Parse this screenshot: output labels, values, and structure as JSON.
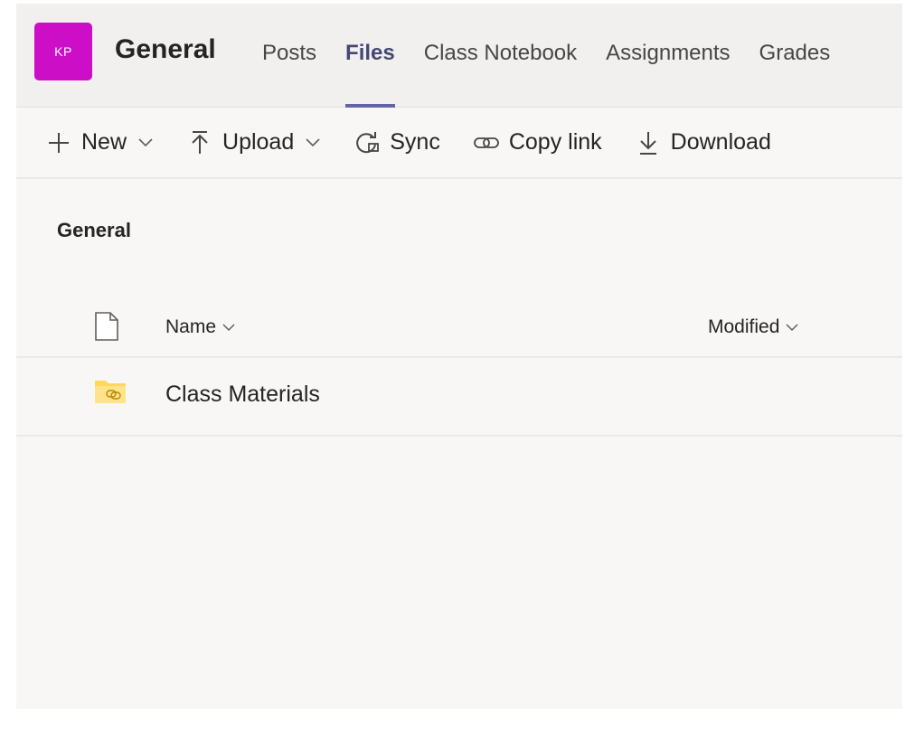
{
  "team": {
    "avatar_initials": "KP",
    "avatar_color": "#cc0ec7",
    "channel_name": "General"
  },
  "tabs": [
    {
      "label": "Posts",
      "active": false
    },
    {
      "label": "Files",
      "active": true
    },
    {
      "label": "Class Notebook",
      "active": false
    },
    {
      "label": "Assignments",
      "active": false
    },
    {
      "label": "Grades",
      "active": false
    }
  ],
  "toolbar": {
    "new_label": "New",
    "upload_label": "Upload",
    "sync_label": "Sync",
    "copy_link_label": "Copy link",
    "download_label": "Download"
  },
  "breadcrumb": "General",
  "list": {
    "columns": {
      "name": "Name",
      "modified": "Modified"
    },
    "rows": [
      {
        "name": "Class Materials",
        "type": "shared-folder",
        "modified": ""
      }
    ]
  },
  "colors": {
    "accent": "#6264a7",
    "active_tab_text": "#464775",
    "folder": "#ffd75e"
  },
  "icons": {
    "new": "plus-icon",
    "upload": "upload-icon",
    "sync": "sync-icon",
    "copy_link": "link-icon",
    "download": "download-icon",
    "file_type": "document-icon",
    "folder": "shared-folder-icon"
  }
}
